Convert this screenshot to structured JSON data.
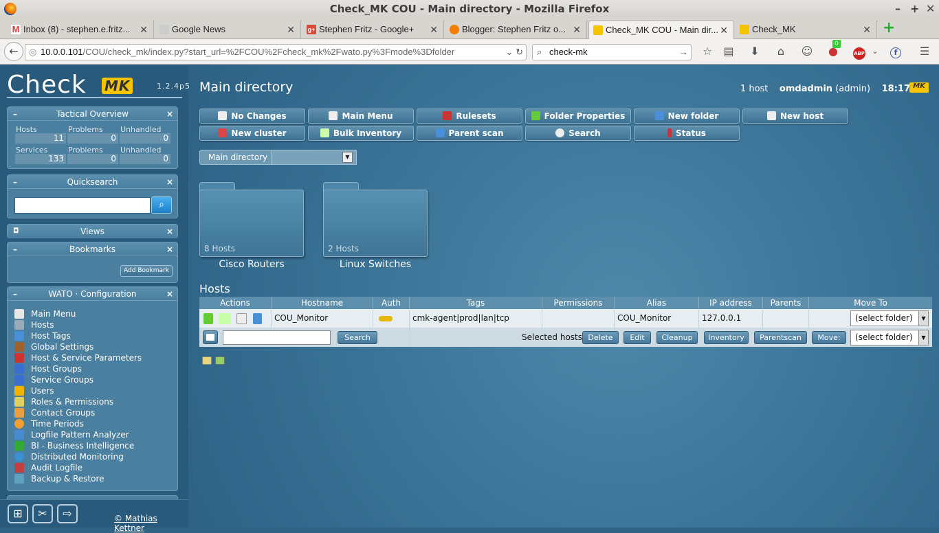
{
  "window": {
    "title": "Check_MK COU - Main directory - Mozilla Firefox"
  },
  "tabs": [
    {
      "label": "Inbox (8) - stephen.e.fritz...",
      "icon": "gmail-icon",
      "color": "#d9443b"
    },
    {
      "label": "Google News",
      "icon": "news-icon",
      "color": "#888888"
    },
    {
      "label": "Stephen Fritz - Google+",
      "icon": "google-plus-icon",
      "color": "#d9483b"
    },
    {
      "label": "Blogger: Stephen Fritz o...",
      "icon": "blogger-icon",
      "color": "#f57d00"
    },
    {
      "label": "Check_MK COU - Main dir...",
      "icon": "checkmk-icon",
      "color": "#f5c400"
    },
    {
      "label": "Check_MK",
      "icon": "checkmk-icon",
      "color": "#f5c400"
    }
  ],
  "nav": {
    "url_host": "10.0.0.101",
    "url_path": "/COU/check_mk/index.py?start_url=%2FCOU%2Fcheck_mk%2Fwato.py%3Fmode%3Dfolder",
    "search_value": "check-mk",
    "badge_count": "0",
    "abp": "ABP"
  },
  "sidebar": {
    "logo_text": "Check",
    "logo_mk": "MK",
    "version": "1.2.4p5",
    "tactical": {
      "title": "Tactical Overview",
      "hosts_label": "Hosts",
      "problems_label": "Problems",
      "unhandled_label": "Unhandled",
      "hosts": "11",
      "hosts_problems": "0",
      "hosts_unhandled": "0",
      "services_label": "Services",
      "services": "133",
      "services_problems": "0",
      "services_unhandled": "0"
    },
    "quicksearch": {
      "title": "Quicksearch",
      "value": ""
    },
    "views": {
      "title": "Views"
    },
    "bookmarks": {
      "title": "Bookmarks",
      "add_label": "Add Bookmark"
    },
    "wato": {
      "title": "WATO · Configuration",
      "items": [
        {
          "label": "Main Menu",
          "icon": "home-icon",
          "color": "#e8e8e8"
        },
        {
          "label": "Hosts",
          "icon": "hosts-icon",
          "color": "#9ab"
        },
        {
          "label": "Host Tags",
          "icon": "tags-icon",
          "color": "#4a90d9"
        },
        {
          "label": "Global Settings",
          "icon": "settings-icon",
          "color": "#a0622d"
        },
        {
          "label": "Host & Service Parameters",
          "icon": "rulesets-icon",
          "color": "#c33"
        },
        {
          "label": "Host Groups",
          "icon": "host-groups-icon",
          "color": "#3a6fd0"
        },
        {
          "label": "Service Groups",
          "icon": "service-groups-icon",
          "color": "#3a6fd0"
        },
        {
          "label": "Users",
          "icon": "users-icon",
          "color": "#f0b400"
        },
        {
          "label": "Roles & Permissions",
          "icon": "roles-icon",
          "color": "#e0d060"
        },
        {
          "label": "Contact Groups",
          "icon": "contact-groups-icon",
          "color": "#e8a040"
        },
        {
          "label": "Time Periods",
          "icon": "clock-icon",
          "color": "#f0a030"
        },
        {
          "label": "Logfile Pattern Analyzer",
          "icon": "logfile-icon",
          "color": "#4a8ad0"
        },
        {
          "label": "BI - Business Intelligence",
          "icon": "bi-icon",
          "color": "#3a3"
        },
        {
          "label": "Distributed Monitoring",
          "icon": "sites-icon",
          "color": "#3a90d0"
        },
        {
          "label": "Audit Logfile",
          "icon": "audit-icon",
          "color": "#c04040"
        },
        {
          "label": "Backup & Restore",
          "icon": "backup-icon",
          "color": "#60a0c0"
        }
      ]
    },
    "footer_credit": "© Mathias Kettner"
  },
  "main": {
    "title": "Main directory",
    "host_count": "1 host",
    "user": "omdadmin",
    "role": "(admin)",
    "time": "18:17",
    "mk_badge": "MK",
    "buttons_row1": [
      {
        "label": "No Changes",
        "icon": "warning-icon",
        "color": "#eee"
      },
      {
        "label": "Main Menu",
        "icon": "home-icon",
        "color": "#eee"
      },
      {
        "label": "Rulesets",
        "icon": "rulesets-icon",
        "color": "#c33"
      },
      {
        "label": "Folder Properties",
        "icon": "edit-icon",
        "color": "#6c3"
      },
      {
        "label": "New folder",
        "icon": "new-folder-icon",
        "color": "#4a90d9"
      },
      {
        "label": "New host",
        "icon": "new-host-icon",
        "color": "#eee"
      }
    ],
    "buttons_row2": [
      {
        "label": "New cluster",
        "icon": "new-cluster-icon",
        "color": "#d44"
      },
      {
        "label": "Bulk Inventory",
        "icon": "inventory-icon",
        "color": "#cfa"
      },
      {
        "label": "Parent scan",
        "icon": "parent-scan-icon",
        "color": "#4a90d9"
      },
      {
        "label": "Search",
        "icon": "search-icon",
        "color": "#eee"
      },
      {
        "label": "Status",
        "icon": "status-icon",
        "color": "#c33"
      }
    ],
    "breadcrumb": "Main directory",
    "folders": [
      {
        "name": "Cisco Routers",
        "count": "8 Hosts"
      },
      {
        "name": "Linux Switches",
        "count": "2 Hosts"
      }
    ],
    "hosts_title": "Hosts",
    "columns": [
      "Actions",
      "Hostname",
      "Auth",
      "Tags",
      "Permissions",
      "Alias",
      "IP address",
      "Parents",
      "Move To"
    ],
    "rows": [
      {
        "hostname": "COU_Monitor",
        "tags": "cmk-agent|prod|lan|tcp",
        "permissions": "",
        "alias": "COU_Monitor",
        "ip": "127.0.0.1",
        "parents": "",
        "move_to": "(select folder)"
      }
    ],
    "search_value": "",
    "search_label": "Search",
    "selected_hosts_label": "Selected hosts:",
    "bulk_buttons": [
      "Delete",
      "Edit",
      "Cleanup",
      "Inventory",
      "Parentscan",
      "Move:"
    ],
    "bulk_move_to": "(select folder)"
  }
}
